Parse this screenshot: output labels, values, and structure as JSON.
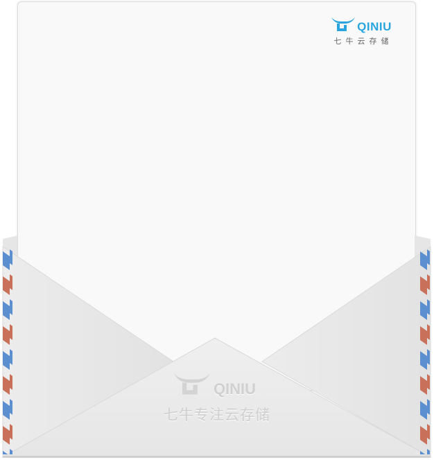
{
  "letter": {
    "brand_word": "QINIU",
    "brand_sub": "七牛云存储"
  },
  "envelope": {
    "brand_word": "QINIU",
    "slogan": "七牛专注云存储"
  },
  "colors": {
    "brand": "#29a4df",
    "stripe_blue": "#5b8fd0",
    "stripe_red": "#c9705a"
  }
}
